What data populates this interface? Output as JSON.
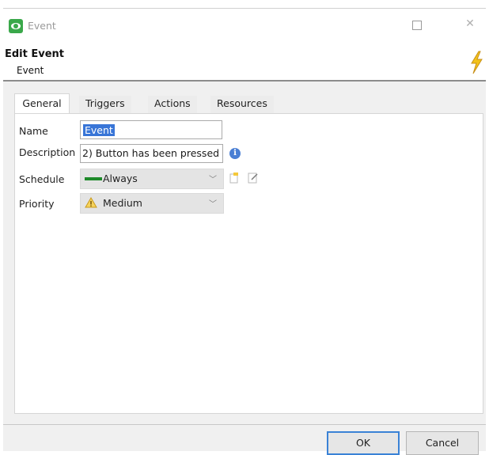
{
  "window": {
    "title": "Event"
  },
  "header": {
    "title": "Edit Event",
    "subtitle": "Event"
  },
  "tabs": [
    {
      "label": "General",
      "active": true
    },
    {
      "label": "Triggers",
      "active": false
    },
    {
      "label": "Actions",
      "active": false
    },
    {
      "label": "Resources",
      "active": false
    }
  ],
  "form": {
    "name_label": "Name",
    "name_value": "Event",
    "description_label": "Description",
    "description_value": "2) Button has been pressed",
    "schedule_label": "Schedule",
    "schedule_value": "Always",
    "priority_label": "Priority",
    "priority_value": "Medium"
  },
  "footer": {
    "ok_label": "OK",
    "cancel_label": "Cancel"
  },
  "colors": {
    "accent": "#3875d7",
    "schedule_bar": "#1e8a2a",
    "ok_border": "#3a82d6"
  },
  "icons": {
    "app": "event-app-icon",
    "header": "lightning-bolt-icon",
    "info": "info-icon",
    "schedule_status": "green-bar-icon",
    "priority_status": "warning-triangle-icon",
    "schedule_new": "new-schedule-icon",
    "schedule_edit": "edit-schedule-icon"
  }
}
